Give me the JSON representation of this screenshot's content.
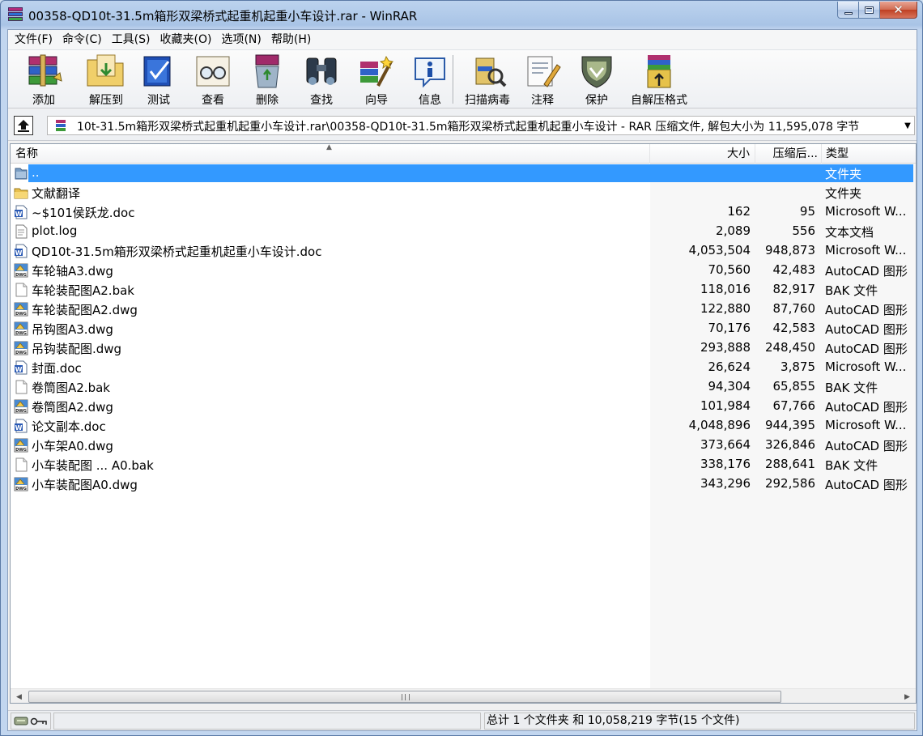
{
  "window": {
    "title": "00358-QD10t-31.5m箱形双梁桥式起重机起重小车设计.rar - WinRAR",
    "minimize_icon": "minimize-icon",
    "maximize_icon": "maximize-icon",
    "close_icon": "close-icon"
  },
  "menu": [
    "文件(F)",
    "命令(C)",
    "工具(S)",
    "收藏夹(O)",
    "选项(N)",
    "帮助(H)"
  ],
  "toolbar": {
    "add": "添加",
    "extract": "解压到",
    "test": "测试",
    "view": "查看",
    "delete": "删除",
    "find": "查找",
    "wizard": "向导",
    "info": "信息",
    "scan": "扫描病毒",
    "comment": "注释",
    "protect": "保护",
    "sfx": "自解压格式"
  },
  "address": {
    "text": "10t-31.5m箱形双梁桥式起重机起重小车设计.rar\\00358-QD10t-31.5m箱形双梁桥式起重机起重小车设计 - RAR 压缩文件, 解包大小为 11,595,078 字节"
  },
  "columns": {
    "name": "名称",
    "size": "大小",
    "packed": "压缩后...",
    "type": "类型"
  },
  "files": [
    {
      "name": "..",
      "size": "",
      "packed": "",
      "type": "文件夹",
      "icon": "parent-folder-icon"
    },
    {
      "name": "文献翻译",
      "size": "",
      "packed": "",
      "type": "文件夹",
      "icon": "folder-icon"
    },
    {
      "name": "~$101侯跃龙.doc",
      "size": "162",
      "packed": "95",
      "type": "Microsoft W...",
      "icon": "word-doc-icon"
    },
    {
      "name": "plot.log",
      "size": "2,089",
      "packed": "556",
      "type": "文本文档",
      "icon": "text-file-icon"
    },
    {
      "name": "QD10t-31.5m箱形双梁桥式起重机起重小车设计.doc",
      "size": "4,053,504",
      "packed": "948,873",
      "type": "Microsoft W...",
      "icon": "word-doc-icon"
    },
    {
      "name": "车轮轴A3.dwg",
      "size": "70,560",
      "packed": "42,483",
      "type": "AutoCAD 图形",
      "icon": "dwg-file-icon"
    },
    {
      "name": "车轮装配图A2.bak",
      "size": "118,016",
      "packed": "82,917",
      "type": "BAK 文件",
      "icon": "blank-file-icon"
    },
    {
      "name": "车轮装配图A2.dwg",
      "size": "122,880",
      "packed": "87,760",
      "type": "AutoCAD 图形",
      "icon": "dwg-file-icon"
    },
    {
      "name": "吊钩图A3.dwg",
      "size": "70,176",
      "packed": "42,583",
      "type": "AutoCAD 图形",
      "icon": "dwg-file-icon"
    },
    {
      "name": "吊钩装配图.dwg",
      "size": "293,888",
      "packed": "248,450",
      "type": "AutoCAD 图形",
      "icon": "dwg-file-icon"
    },
    {
      "name": "封面.doc",
      "size": "26,624",
      "packed": "3,875",
      "type": "Microsoft W...",
      "icon": "word-doc-icon"
    },
    {
      "name": "卷筒图A2.bak",
      "size": "94,304",
      "packed": "65,855",
      "type": "BAK 文件",
      "icon": "blank-file-icon"
    },
    {
      "name": "卷筒图A2.dwg",
      "size": "101,984",
      "packed": "67,766",
      "type": "AutoCAD 图形",
      "icon": "dwg-file-icon"
    },
    {
      "name": "论文副本.doc",
      "size": "4,048,896",
      "packed": "944,395",
      "type": "Microsoft W...",
      "icon": "word-doc-icon"
    },
    {
      "name": "小车架A0.dwg",
      "size": "373,664",
      "packed": "326,846",
      "type": "AutoCAD 图形",
      "icon": "dwg-file-icon"
    },
    {
      "name": "小车装配图 ... A0.bak",
      "size": "338,176",
      "packed": "288,641",
      "type": "BAK 文件",
      "icon": "blank-file-icon"
    },
    {
      "name": "小车装配图A0.dwg",
      "size": "343,296",
      "packed": "292,586",
      "type": "AutoCAD 图形",
      "icon": "dwg-file-icon"
    }
  ],
  "status": {
    "right": "总计 1 个文件夹 和 10,058,219 字节(15 个文件)"
  },
  "colors": {
    "selection": "#3399ff",
    "titlebar": "#bcd3ee"
  }
}
